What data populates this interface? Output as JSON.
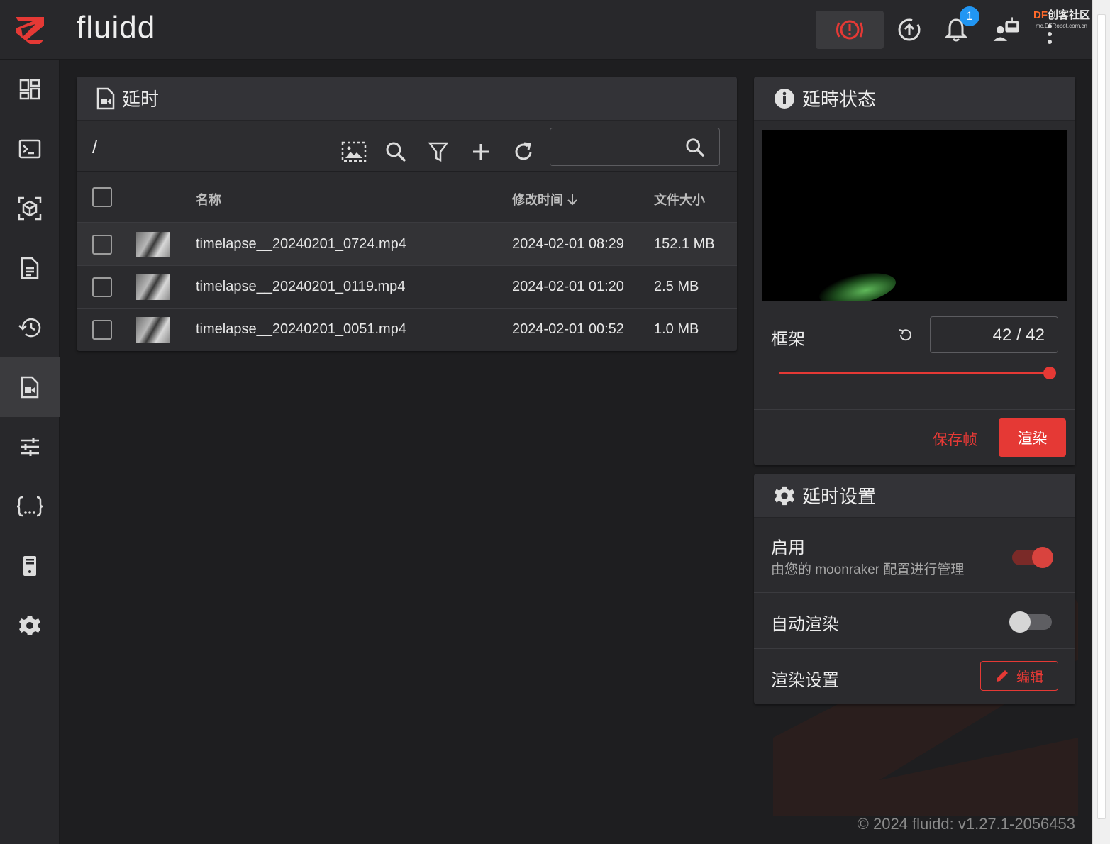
{
  "app": {
    "title": "fluidd"
  },
  "topbar": {
    "notification_count": "1",
    "watermark_brand": "DF",
    "watermark_text": "创客社区",
    "watermark_url": "mc.DFRobot.com.cn"
  },
  "files": {
    "title": "延时",
    "path": "/",
    "search_placeholder": "",
    "columns": {
      "name": "名称",
      "modified": "修改时间",
      "size": "文件大小"
    },
    "rows": [
      {
        "name": "timelapse__20240201_0724.mp4",
        "modified": "2024-02-01 08:29",
        "size": "152.1 MB"
      },
      {
        "name": "timelapse__20240201_0119.mp4",
        "modified": "2024-02-01 01:20",
        "size": "2.5 MB"
      },
      {
        "name": "timelapse__20240201_0051.mp4",
        "modified": "2024-02-01 00:52",
        "size": "1.0 MB"
      }
    ]
  },
  "status": {
    "title": "延時状态",
    "frame_label": "框架",
    "frame_value": "42 / 42",
    "frame_progress": 1.0,
    "save_frame_label": "保存帧",
    "render_label": "渲染"
  },
  "settings": {
    "title": "延时设置",
    "enable_label": "启用",
    "enable_sub": "由您的 moonraker 配置进行管理",
    "enable_on": true,
    "autorender_label": "自动渲染",
    "autorender_on": false,
    "render_settings_label": "渲染设置",
    "edit_label": "编辑"
  },
  "footer": {
    "text": "© 2024 fluidd: v1.27.1-2056453"
  },
  "colors": {
    "accent": "#e53935",
    "badge": "#2196f3",
    "background": "#1e1e20",
    "card": "#2b2b2e"
  }
}
